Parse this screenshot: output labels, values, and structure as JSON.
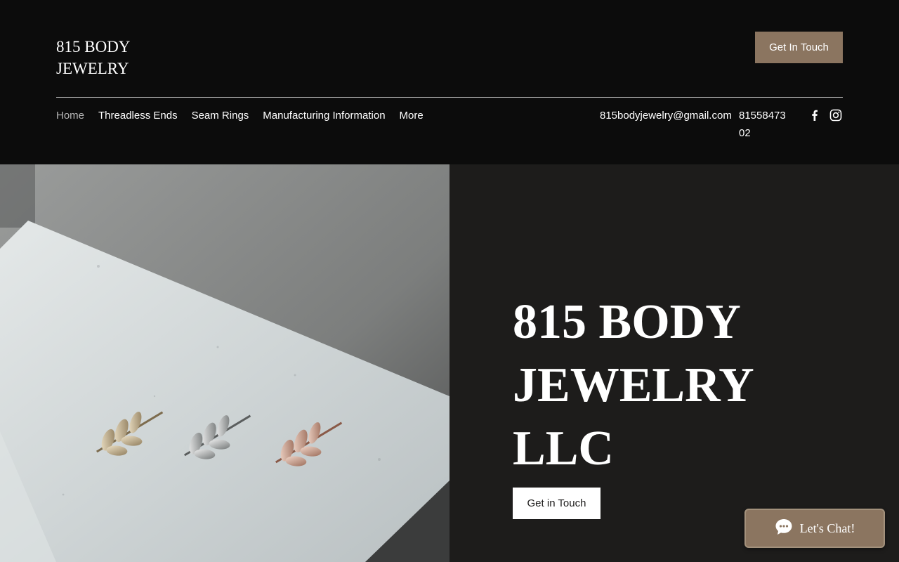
{
  "header": {
    "logo_line1": "815 BODY",
    "logo_line2": "JEWELRY",
    "cta_label": "Get In Touch",
    "nav": {
      "items": [
        {
          "label": "Home"
        },
        {
          "label": "Threadless Ends"
        },
        {
          "label": "Seam Rings"
        },
        {
          "label": "Manufacturing Information"
        },
        {
          "label": "More"
        }
      ]
    },
    "email": "815bodyjewelry@gmail.com",
    "phone": "8155847302",
    "social": [
      {
        "icon": "facebook-icon"
      },
      {
        "icon": "instagram-icon"
      }
    ]
  },
  "hero": {
    "title_line1": "815 BODY",
    "title_line2": "JEWELRY",
    "title_line3": "LLC",
    "cta_label": "Get in Touch"
  },
  "chat": {
    "label": "Let's Chat!",
    "icon": "chat-bubble-icon"
  },
  "colors": {
    "header_bg": "#0c0c0c",
    "accent": "#8b7560",
    "hero_panel_bg": "#1d1c1b"
  }
}
